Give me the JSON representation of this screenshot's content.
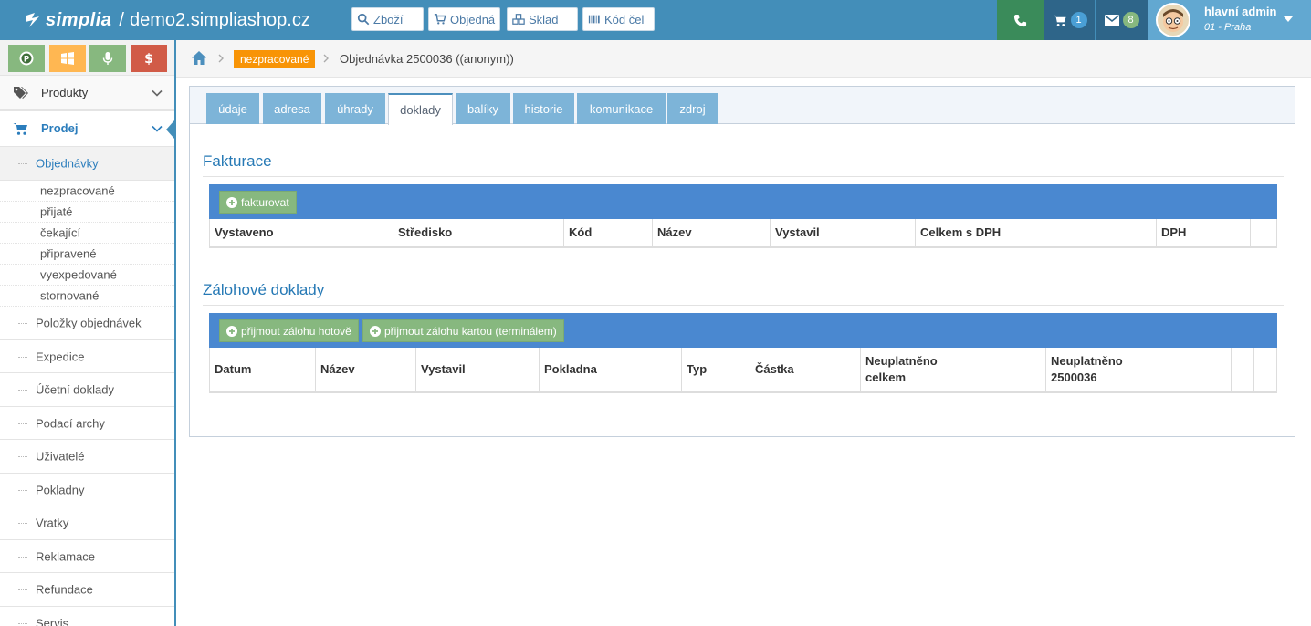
{
  "header": {
    "brand_logo": "simplia",
    "separator": "/",
    "domain": "demo2.simpliashop.cz",
    "search_buttons": [
      {
        "label": "Zboží",
        "icon": "search-icon"
      },
      {
        "label": "Objedná",
        "icon": "cart-icon"
      },
      {
        "label": "Sklad",
        "icon": "cubes-icon"
      },
      {
        "label": "Kód čel",
        "icon": "barcode-icon"
      }
    ],
    "cart_count": "1",
    "messages_count": "8",
    "user_name": "hlavní admin",
    "user_branch": "01 - Praha"
  },
  "colors": {
    "topbar": "#438eb9",
    "phone_bg": "#3a8b5a",
    "cart_bg": "#2e6589",
    "messages_bg": "#2e6589",
    "user_bg": "#62a8d1",
    "badge_cart": "#4a9fd5",
    "badge_messages": "#87b87f",
    "status_orange": "#f89406",
    "bar_blue": "#4a88d0",
    "btn_green": "#87b87f"
  },
  "sidebar": {
    "shortcuts": [
      {
        "icon": "parking-icon",
        "color": "#87b87f"
      },
      {
        "icon": "windows-icon",
        "color": "#ffb752"
      },
      {
        "icon": "microphone-icon",
        "color": "#87b87f"
      },
      {
        "icon": "dollar-icon",
        "color": "#d15b47"
      }
    ],
    "top_items": [
      {
        "label": "Produkty",
        "icon": "tags-icon"
      },
      {
        "label": "Prodej",
        "icon": "cart-icon"
      }
    ],
    "sub_items": [
      {
        "label": "Objednávky"
      },
      {
        "label": "nezpracované"
      },
      {
        "label": "přijaté"
      },
      {
        "label": "čekající"
      },
      {
        "label": "připravené"
      },
      {
        "label": "vyexpedované"
      },
      {
        "label": "stornované"
      },
      {
        "label": "Položky objednávek"
      },
      {
        "label": "Expedice"
      },
      {
        "label": "Účetní doklady"
      },
      {
        "label": "Podací archy"
      },
      {
        "label": "Uživatelé"
      },
      {
        "label": "Pokladny"
      },
      {
        "label": "Vratky"
      },
      {
        "label": "Reklamace"
      },
      {
        "label": "Refundace"
      },
      {
        "label": "Servis"
      }
    ]
  },
  "breadcrumb": {
    "status": "nezpracované",
    "order": "Objednávka 2500036 ((anonym))"
  },
  "tabs": [
    "údaje",
    "adresa",
    "úhrady",
    "doklady",
    "balíky",
    "historie",
    "komunikace",
    "zdroj"
  ],
  "active_tab": "doklady",
  "invoicing": {
    "title": "Fakturace",
    "button": "fakturovat",
    "columns": [
      "Vystaveno",
      "Středisko",
      "Kód",
      "Název",
      "Vystavil",
      "Celkem s DPH",
      "DPH",
      ""
    ]
  },
  "deposits": {
    "title": "Zálohové doklady",
    "buttons": [
      "přijmout zálohu hotově",
      "přijmout zálohu kartou (terminálem)"
    ],
    "columns": [
      "Datum",
      "Název",
      "Vystavil",
      "Pokladna",
      "Typ",
      "Částka",
      "Neuplatněno celkem",
      "Neuplatněno 2500036",
      "",
      ""
    ]
  }
}
